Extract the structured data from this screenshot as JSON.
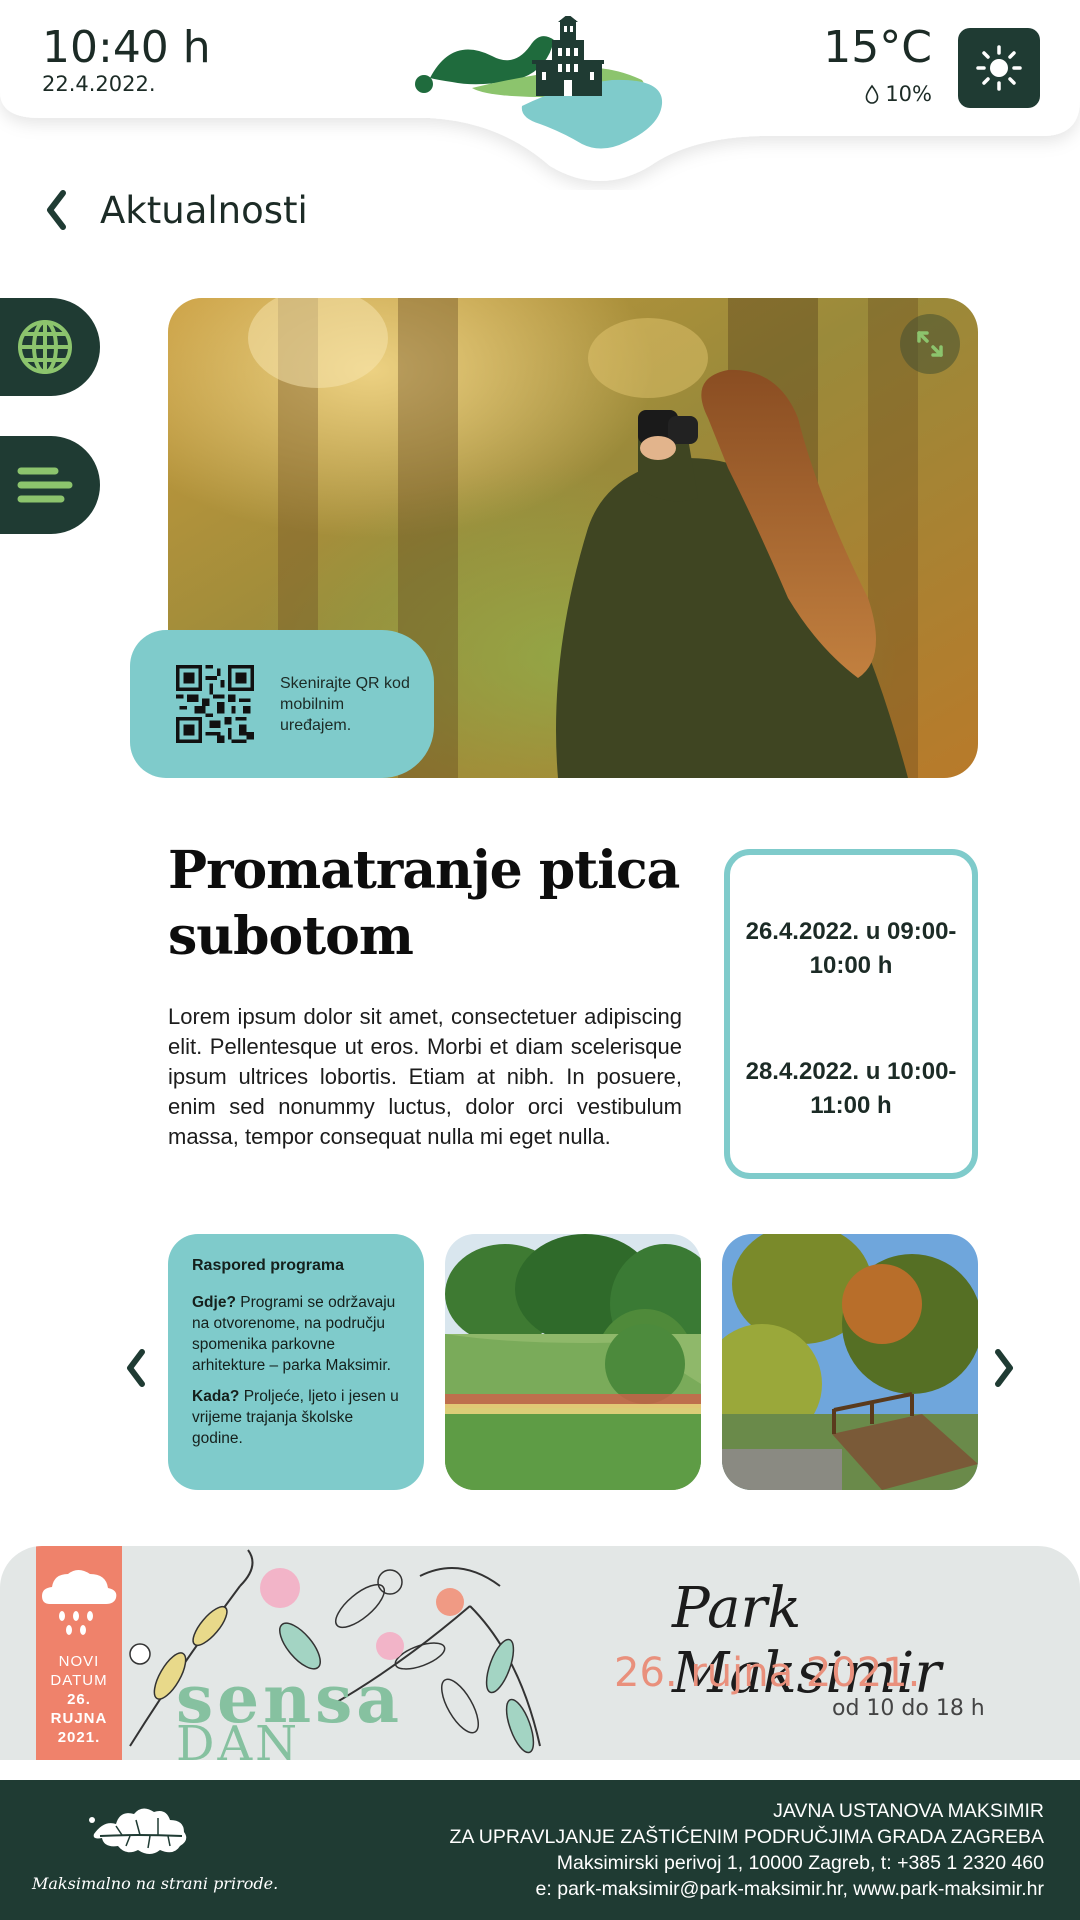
{
  "header": {
    "time": "10:40 h",
    "date": "22.4.2022.",
    "temperature": "15°C",
    "humidity": "10%",
    "weather_icon": "sun-icon"
  },
  "nav": {
    "back_title": "Aktualnosti"
  },
  "side_tabs": [
    {
      "icon": "globe-icon"
    },
    {
      "icon": "menu-lines-icon"
    }
  ],
  "hero": {
    "qr_text": "Skenirajte QR kod mobilnim uređajem."
  },
  "event": {
    "title": "Promatranje ptica subotom",
    "description": "Lorem ipsum dolor sit amet, consectetuer adipiscing elit. Pellentesque ut eros. Morbi et diam scelerisque ipsum ultrices lobortis. Etiam at nibh. In posuere, enim sed nonummy luctus, dolor orci vestibulum massa, tempor consequat nulla mi eget nulla.",
    "dates": [
      "26.4.2022. u 09:00-10:00 h",
      "28.4.2022. u 10:00-11:00 h"
    ]
  },
  "program": {
    "title": "Raspored programa",
    "where_label": "Gdje?",
    "where_text": "Programi se održavaju na otvorenome, na području spomenika parkovne arhitekture – parka Maksimir.",
    "when_label": "Kada?",
    "when_text": "Proljeće, ljeto i jesen u vrijeme trajanja školske godine."
  },
  "banner": {
    "flag_lines": [
      "NOVI",
      "DATUM",
      "26.",
      "RUJNA",
      "2021."
    ],
    "event_name_1": "sensa",
    "event_name_2": "DAN",
    "park": "Park Maksimir",
    "date": "26. rujna 2021.",
    "hours": "od 10 do 18 h"
  },
  "footer": {
    "slogan": "Maksimalno na strani prirode.",
    "lines": [
      "JAVNA USTANOVA MAKSIMIR",
      "ZA UPRAVLJANJE ZAŠTIĆENIM PODRUČJIMA GRADA ZAGREBA",
      "Maksimirski perivoj 1, 10000 Zagreb, t: +385 1 2320 460",
      "e: park-maksimir@park-maksimir.hr, www.park-maksimir.hr"
    ]
  },
  "colors": {
    "dark_green": "#1f3b33",
    "teal": "#7fcbcb",
    "light_green": "#8cc46d",
    "coral": "#ef826b"
  }
}
